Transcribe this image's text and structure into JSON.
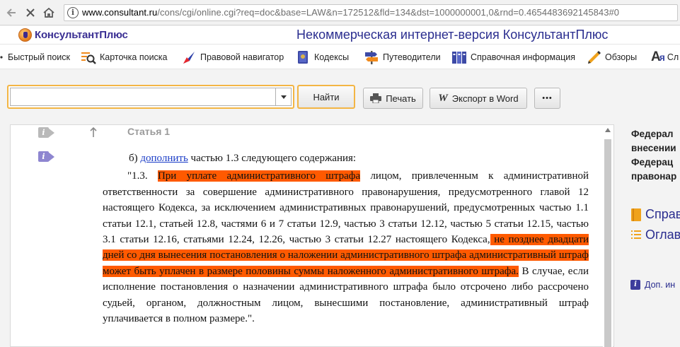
{
  "browser": {
    "url_host": "www.consultant.ru",
    "url_rest": "/cons/cgi/online.cgi?req=doc&base=LAW&n=172512&fld=134&dst=1000000001,0&rnd=0.4654483692145843#0"
  },
  "header": {
    "logo_text": "КонсультантПлюс",
    "title": "Некоммерческая интернет-версия КонсультантПлюс"
  },
  "toolbar": {
    "items": [
      {
        "label": "Быстрый поиск",
        "icon": "quick-search-icon"
      },
      {
        "label": "Карточка поиска",
        "icon": "search-card-icon"
      },
      {
        "label": "Правовой навигатор",
        "icon": "legal-navigator-icon"
      },
      {
        "label": "Кодексы",
        "icon": "codes-icon"
      },
      {
        "label": "Путеводители",
        "icon": "guides-icon"
      },
      {
        "label": "Справочная информация",
        "icon": "reference-icon"
      },
      {
        "label": "Обзоры",
        "icon": "reviews-icon"
      },
      {
        "label": "Сл",
        "icon": "dictionary-icon"
      }
    ]
  },
  "search": {
    "value": "",
    "find_label": "Найти",
    "print_label": "Печать",
    "export_label": "Экспорт в Word",
    "more_label": "•••"
  },
  "document": {
    "article_heading": "Статья 1",
    "p1_prefix": "б) ",
    "p1_link": "дополнить",
    "p1_suffix": " частью 1.3 следующего содержания:",
    "p2_lead": "\"1.3. ",
    "p2_hl1": "При уплате административного штрафа",
    "p2_mid": " лицом, привлеченным к административной ответственности за совершение административного правонарушения, предусмотренного главой 12 настоящего Кодекса, за исключением административных правонарушений, предусмотренных частью 1.1 статьи 12.1, статьей 12.8, частями 6 и 7 статьи 12.9, частью 3 статьи 12.12, частью 5 статьи 12.15, частью 3.1 статьи 12.16, статьями 12.24, 12.26, частью 3 статьи 12.27 настоящего Кодекса,",
    "p2_hl2": " не позднее двадцати дней со дня вынесения постановления о наложении административного штрафа административный штраф может быть уплачен в размере половины суммы наложенного административного штрафа.",
    "p2_tail": " В случае, если исполнение постановления о назначении административного штрафа было отсрочено либо рассрочено судьей, органом, должностным лицом, вынесшими постановление, административный штраф уплачивается в полном размере.\"."
  },
  "side": {
    "title_lines": [
      "Федерал",
      "внесении",
      "Федерац",
      "правонар"
    ],
    "link1": "Справ",
    "link2": "Оглав",
    "small_link": "Доп. ин"
  },
  "colors": {
    "highlight": "#ff5a00",
    "brand": "#2a2d8f",
    "focus_border": "#f3b544"
  }
}
